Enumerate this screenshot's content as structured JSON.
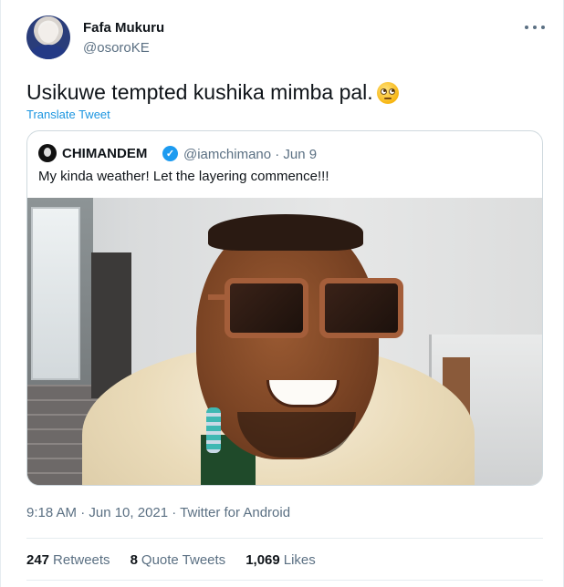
{
  "author": {
    "name": "Fafa Mukuru",
    "handle": "@osoroKE"
  },
  "tweet": {
    "text": "Usikuwe tempted kushika mimba pal.",
    "emoji": "face-with-rolling-eyes",
    "translate_label": "Translate Tweet"
  },
  "quoted": {
    "name": "CHIMANDEM",
    "verified": true,
    "handle_and_date": "@iamchimano · Jun 9",
    "text": "My kinda weather! Let the layering commence!!!"
  },
  "meta": {
    "timestamp": "9:18 AM · Jun 10, 2021 · Twitter for Android"
  },
  "stats": {
    "retweets_count": "247",
    "retweets_label": "Retweets",
    "quote_count": "8",
    "quote_label": "Quote Tweets",
    "likes_count": "1,069",
    "likes_label": "Likes"
  },
  "colors": {
    "link": "#1b95e0",
    "muted": "#5b7083",
    "verified": "#1d9bf0"
  }
}
